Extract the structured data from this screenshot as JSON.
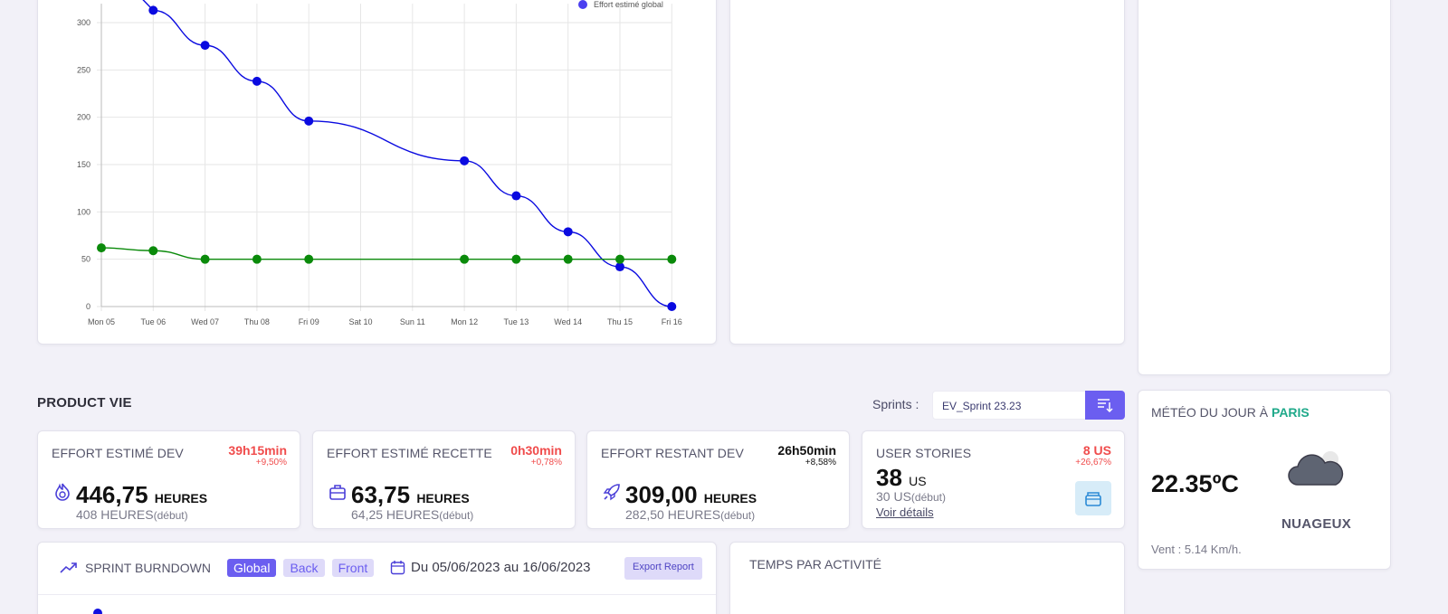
{
  "chart_data": {
    "type": "line",
    "x": [
      "Mon 05",
      "Tue 06",
      "Wed 07",
      "Thu 08",
      "Fri 09",
      "Sat 10",
      "Sun 11",
      "Mon 12",
      "Tue 13",
      "Wed 14",
      "Thu 15",
      "Fri 16"
    ],
    "yticks": [
      "0",
      "50",
      "100",
      "150",
      "200",
      "250",
      "300"
    ],
    "ylim": [
      0,
      320
    ],
    "series": [
      {
        "name": "Effort estimé global",
        "color": "#0a0ae0",
        "points": [
          [
            1,
            313
          ],
          [
            2,
            276
          ],
          [
            3,
            238
          ],
          [
            4,
            196
          ],
          [
            7,
            154
          ],
          [
            8,
            117
          ],
          [
            9,
            79
          ],
          [
            10,
            42
          ],
          [
            11,
            0
          ]
        ]
      },
      {
        "name": "",
        "color": "#0a8a0a",
        "points": [
          [
            0,
            62
          ],
          [
            1,
            59
          ],
          [
            2,
            50
          ],
          [
            3,
            50
          ],
          [
            4,
            50
          ],
          [
            7,
            50
          ],
          [
            8,
            50
          ],
          [
            9,
            50
          ],
          [
            10,
            50
          ],
          [
            11,
            50
          ]
        ]
      }
    ],
    "legend": "top-right",
    "grid": true
  },
  "product": {
    "title": "PRODUCT VIE",
    "sprints_label": "Sprints :",
    "sprint_value": "EV_Sprint 23.23"
  },
  "kpis": [
    {
      "title": "EFFORT ESTIMÉ DEV",
      "delta": "39h15min",
      "delta_pct": "+9,50%",
      "value": "446,75",
      "unit": "HEURES",
      "start": "408 HEURES",
      "start_suffix": "(début)",
      "icon": "flame-icon"
    },
    {
      "title": "EFFORT ESTIMÉ RECETTE",
      "delta": "0h30min",
      "delta_pct": "+0,78%",
      "value": "63,75",
      "unit": "HEURES",
      "start": "64,25 HEURES",
      "start_suffix": "(début)",
      "icon": "briefcase-icon"
    },
    {
      "title": "EFFORT RESTANT DEV",
      "delta": "26h50min",
      "delta_pct": "+8,58%",
      "value": "309,00",
      "unit": "HEURES",
      "start": "282,50 HEURES",
      "start_suffix": "(début)",
      "icon": "rocket-icon"
    }
  ],
  "user_stories": {
    "title": "USER STORIES",
    "delta": "8 US",
    "delta_pct": "+26,67%",
    "value": "38",
    "unit": "US",
    "start": "30 US",
    "start_suffix": "(début)",
    "link": "Voir détails"
  },
  "weather": {
    "title": "MÉTÉO DU JOUR À",
    "city": "PARIS",
    "temp": "22.35ºC",
    "desc": "NUAGEUX",
    "wind": "Vent : 5.14 Km/h."
  },
  "burndown": {
    "title": "SPRINT BURNDOWN",
    "tabs": [
      "Global",
      "Back",
      "Front"
    ],
    "active_tab": "Global",
    "date_range": "Du 05/06/2023 au 16/06/2023",
    "export": "Export Report"
  },
  "temps": {
    "title": "TEMPS PAR ACTIVITÉ"
  },
  "colors": {
    "accent": "#6b5ef0",
    "red": "#f04c4c",
    "green": "#1fa98a"
  }
}
